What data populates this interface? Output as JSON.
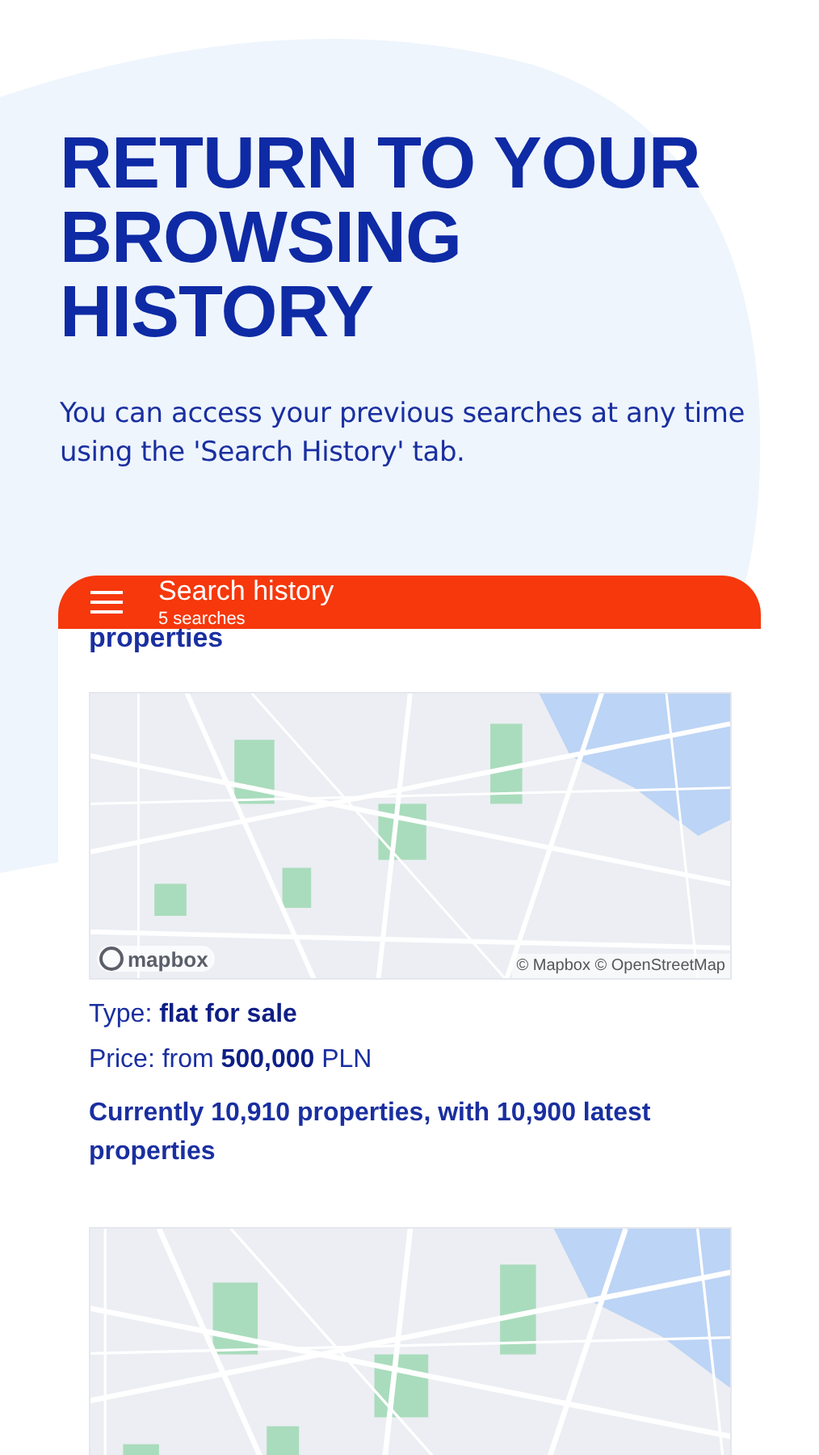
{
  "heading": "RETURN TO YOUR BROWSING HISTORY",
  "subtitle": "You can access your previous searches at any time using the 'Search History' tab.",
  "app_bar": {
    "title": "Search history",
    "subtitle": "5 searches"
  },
  "searches": [
    {
      "kind": "partial",
      "summary": "properties"
    },
    {
      "kind": "full",
      "map_logo": "mapbox",
      "map_attribution": "© Mapbox © OpenStreetMap",
      "type_label": "Type: **flat for sale**",
      "price_label": "Price: from **500,000** PLN",
      "summary": "Currently 10,910 properties, with 10,900 latest properties"
    },
    {
      "kind": "map_only"
    }
  ]
}
